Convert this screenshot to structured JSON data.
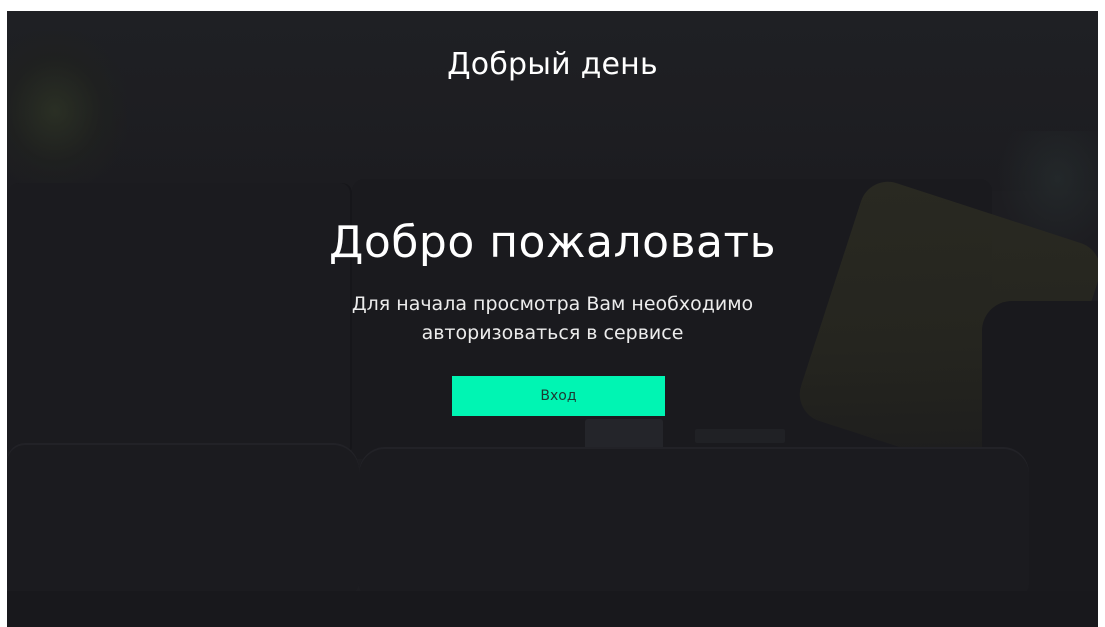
{
  "header": {
    "greeting": "Добрый день"
  },
  "main": {
    "title": "Добро пожаловать",
    "subtitle_lines": [
      "Для начала просмотра Вам необходимо",
      "авторизоваться в сервисе"
    ],
    "login_button_label": "Вход"
  },
  "colors": {
    "background_overlay": "#1d1d21",
    "accent": "#00f5b3",
    "text_primary": "#ffffff",
    "button_text": "#1d3a33"
  }
}
